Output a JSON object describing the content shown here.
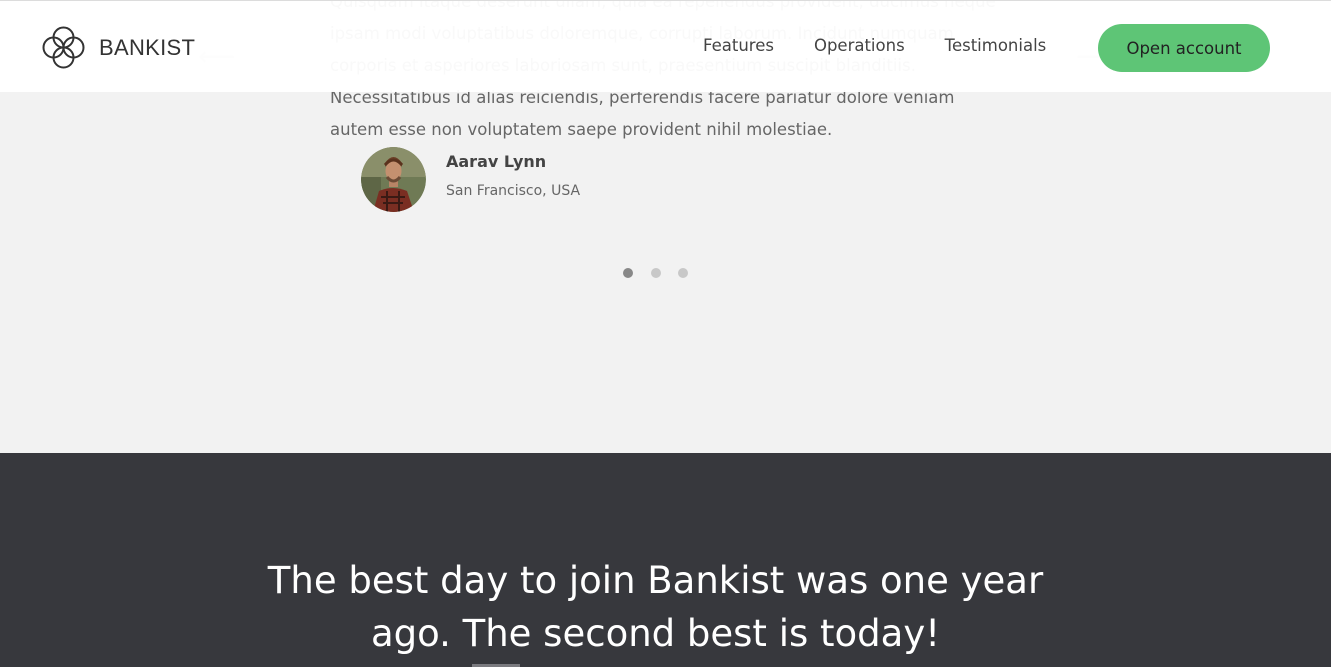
{
  "header": {
    "logo_text": "BANKIST",
    "nav": [
      "Features",
      "Operations",
      "Testimonials"
    ],
    "cta_label": "Open account"
  },
  "testimonial": {
    "quote": "Quisquam itaque deserunt ullam, quia ea repellendus provident, ducimus neque ipsam modi voluptatibus doloremque, corrupti laborum. Incidunt numquam corporis et asperiores laboriosam sunt, praesentium suscipit blanditiis. Necessitatibus id alias reiciendis, perferendis facere pariatur dolore veniam autem esse non voluptatem saepe provident nihil molestiae.",
    "author_name": "Aarav Lynn",
    "author_location": "San Francisco, USA",
    "dots": 3,
    "active_dot": 0
  },
  "signup": {
    "title": "The best day to join Bankist was one year ago. The second best is today!"
  },
  "colors": {
    "accent": "#5ec576",
    "dark_section": "#37383d",
    "light_section": "#f2f2f2"
  },
  "icons": {
    "logo": "bankist-logo-icon",
    "prev": "arrow-left-icon",
    "next": "arrow-right-icon",
    "avatar": "user-avatar"
  }
}
